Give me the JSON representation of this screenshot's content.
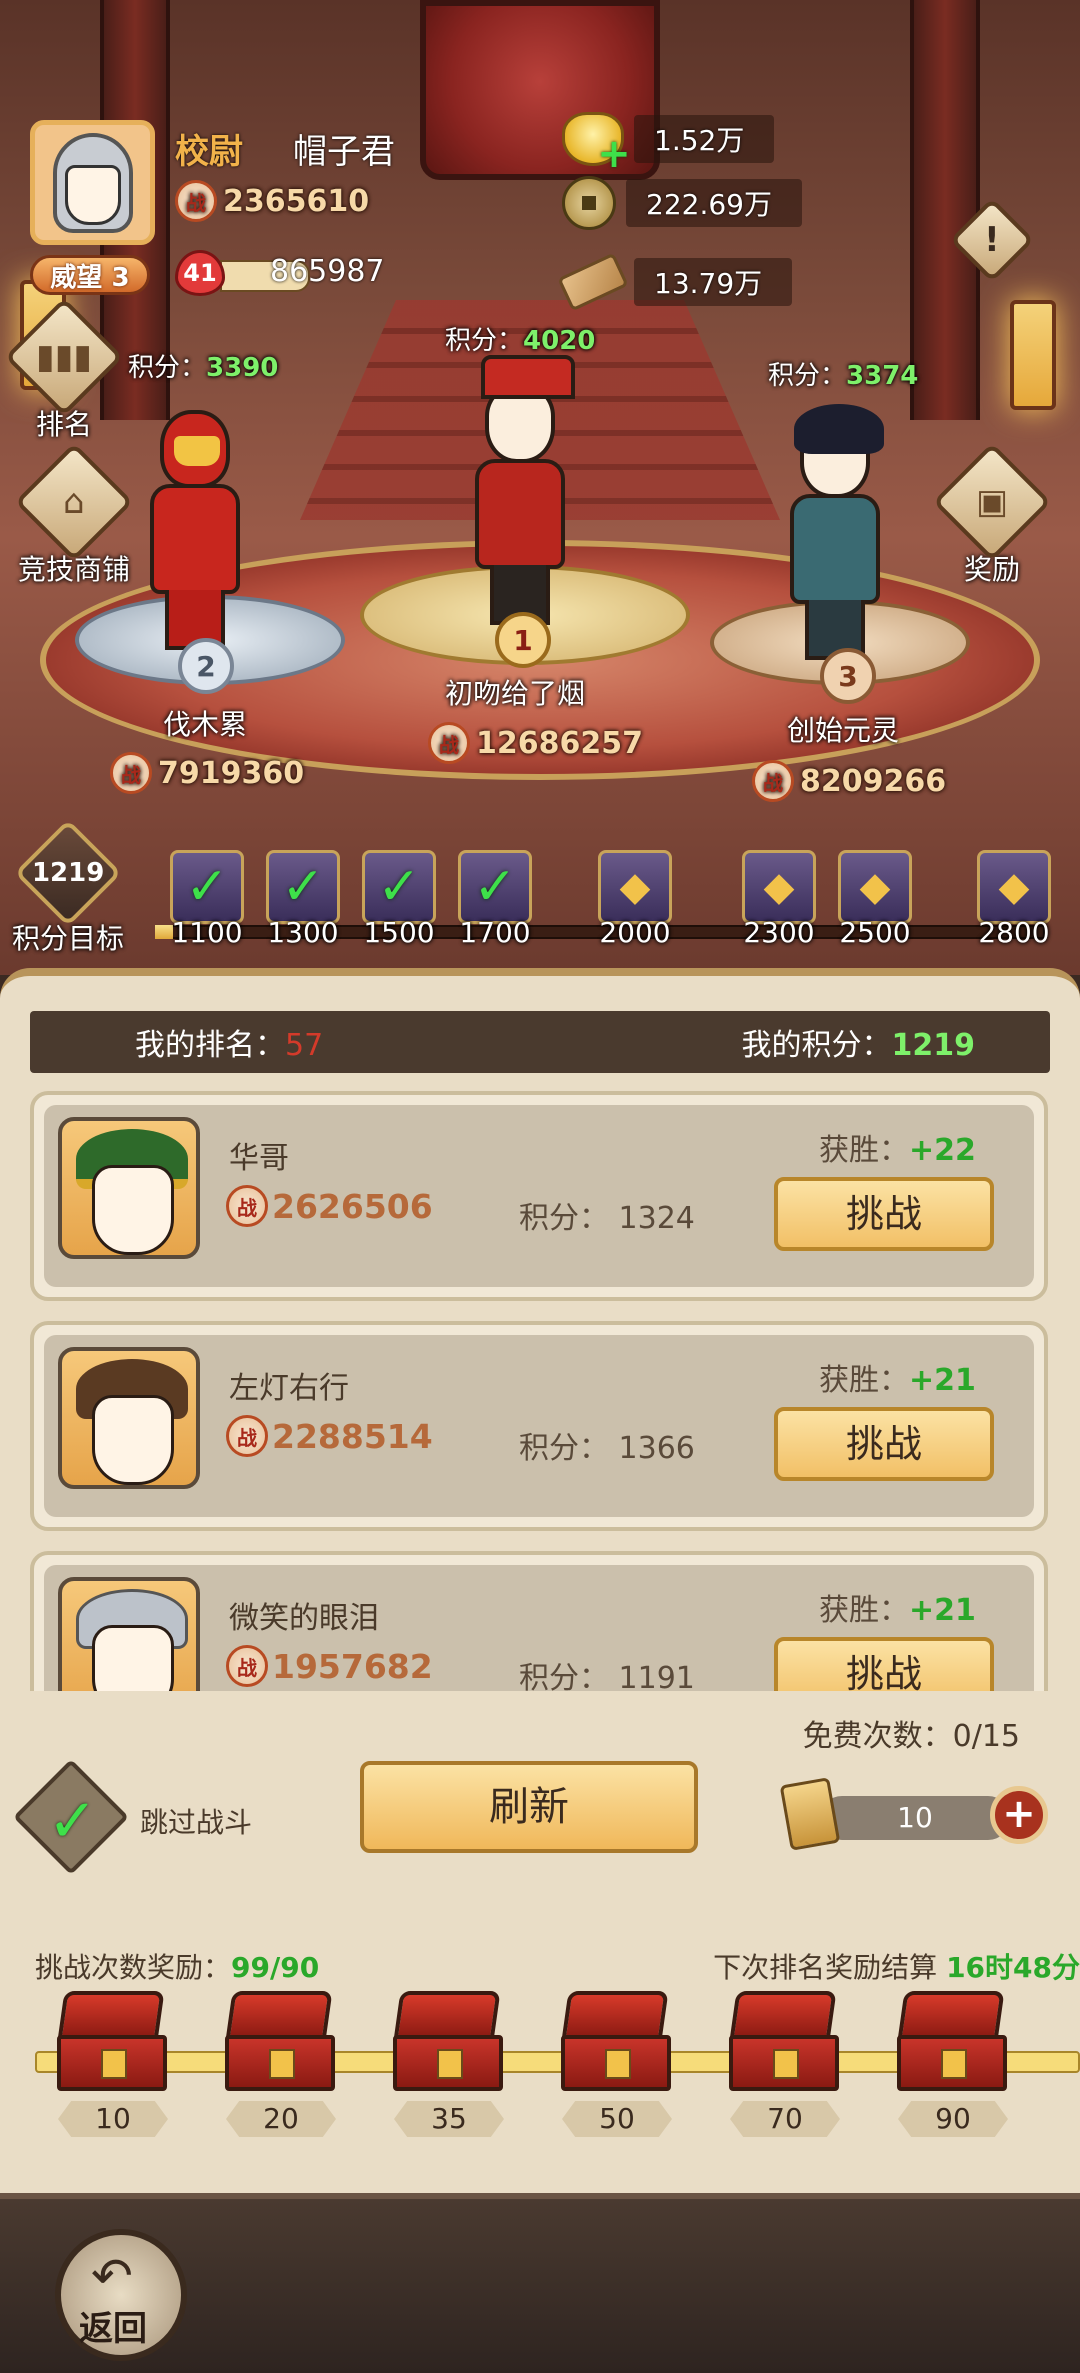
{
  "player": {
    "rank_title": "校尉",
    "name": "帽子君",
    "power": "2365610",
    "prestige": "威望 3",
    "level": "41",
    "exp": "865987"
  },
  "currencies": {
    "gold": "1.52万",
    "coin": "222.69万",
    "wood": "13.79万"
  },
  "side_buttons": {
    "rank": "排名",
    "shop": "竞技商铺",
    "reward": "奖励"
  },
  "score_label": "积分：",
  "podium": [
    {
      "rank": "1",
      "name": "初吻给了烟",
      "score": "4020",
      "power": "12686257"
    },
    {
      "rank": "2",
      "name": "伐木累",
      "score": "3390",
      "power": "7919360"
    },
    {
      "rank": "3",
      "name": "创始元灵",
      "score": "3374",
      "power": "8209266"
    }
  ],
  "score_target": {
    "value": "1219",
    "label": "积分目标",
    "progress_fraction": 0.02
  },
  "milestones": [
    {
      "value": "1100",
      "claimed": true
    },
    {
      "value": "1300",
      "claimed": true
    },
    {
      "value": "1500",
      "claimed": true
    },
    {
      "value": "1700",
      "claimed": true
    },
    {
      "value": "2000",
      "claimed": false
    },
    {
      "value": "2300",
      "claimed": false
    },
    {
      "value": "2500",
      "claimed": false
    },
    {
      "value": "2800",
      "claimed": false
    }
  ],
  "my_rank": {
    "rank_label": "我的排名：",
    "rank_value": "57",
    "score_label": "我的积分：",
    "score_value": "1219"
  },
  "opponents": [
    {
      "name": "华哥",
      "power": "2626506",
      "score": "积分：  1324",
      "win_label": "获胜：",
      "win_value": "+22",
      "button": "挑战"
    },
    {
      "name": "左灯右行",
      "power": "2288514",
      "score": "积分：  1366",
      "win_label": "获胜：",
      "win_value": "+21",
      "button": "挑战"
    },
    {
      "name": "微笑的眼泪",
      "power": "1957682",
      "score": "积分：  1191",
      "win_label": "获胜：",
      "win_value": "+21",
      "button": "挑战"
    }
  ],
  "controls": {
    "free_count": "免费次数：0/15",
    "skip_label": "跳过战斗",
    "refresh": "刷新",
    "tickets": "10",
    "plus": "+"
  },
  "rewards": {
    "title_label": "挑战次数奖励：",
    "title_value": "99/90",
    "settle_label": "下次排名奖励结算 ",
    "settle_value": "16时48分",
    "chests": [
      "10",
      "20",
      "35",
      "50",
      "70",
      "90"
    ]
  },
  "footer": {
    "back": "返回"
  },
  "icons": {
    "battle": "战",
    "check": "✓",
    "alert": "!"
  }
}
